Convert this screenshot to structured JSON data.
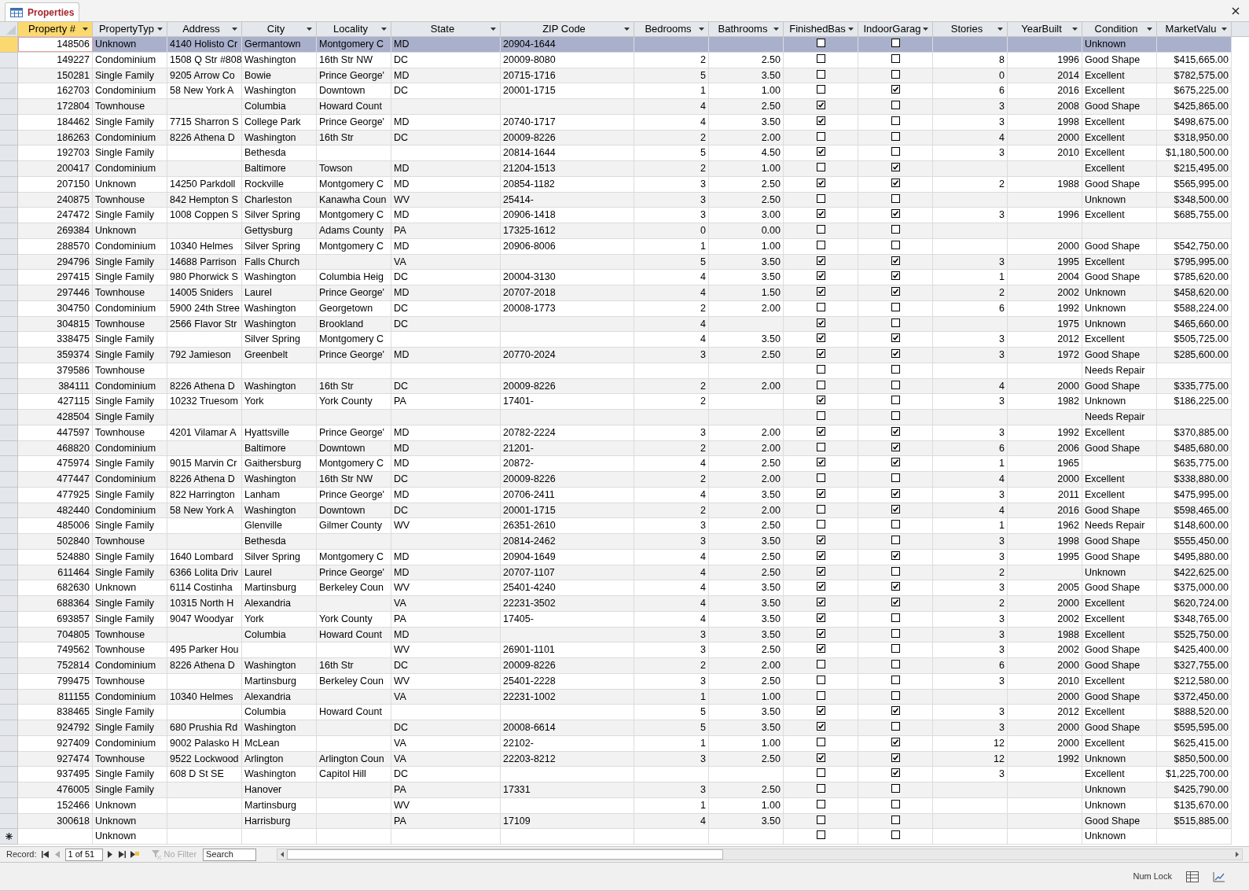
{
  "tab": {
    "title": "Properties"
  },
  "columns": [
    {
      "label": "Property #",
      "kind": "number",
      "selected": true
    },
    {
      "label": "PropertyTyp",
      "kind": "text",
      "selected": false
    },
    {
      "label": "Address",
      "kind": "text",
      "selected": false
    },
    {
      "label": "City",
      "kind": "text",
      "selected": false
    },
    {
      "label": "Locality",
      "kind": "text",
      "selected": false
    },
    {
      "label": "State",
      "kind": "wide",
      "selected": false
    },
    {
      "label": "ZIP Code",
      "kind": "wider",
      "selected": false
    },
    {
      "label": "Bedrooms",
      "kind": "number",
      "selected": false
    },
    {
      "label": "Bathrooms",
      "kind": "number",
      "selected": false
    },
    {
      "label": "FinishedBas",
      "kind": "check",
      "selected": false
    },
    {
      "label": "IndoorGarag",
      "kind": "check",
      "selected": false
    },
    {
      "label": "Stories",
      "kind": "number",
      "selected": false
    },
    {
      "label": "YearBuilt",
      "kind": "number",
      "selected": false
    },
    {
      "label": "Condition",
      "kind": "text",
      "selected": false
    },
    {
      "label": "MarketValu",
      "kind": "number",
      "selected": false
    }
  ],
  "rows": [
    {
      "kind": "record",
      "selected": true,
      "cells": [
        "148506",
        "Unknown",
        "4140 Holisto Cr",
        "Germantown",
        "Montgomery C",
        "MD",
        "20904-1644",
        null,
        null,
        false,
        false,
        null,
        null,
        "Unknown",
        null
      ]
    },
    {
      "kind": "record",
      "selected": false,
      "cells": [
        "149227",
        "Condominium",
        "1508 Q Str #808",
        "Washington",
        "16th Str NW",
        "DC",
        "20009-8080",
        "2",
        "2.50",
        false,
        false,
        "8",
        "1996",
        "Good Shape",
        "$415,665.00"
      ]
    },
    {
      "kind": "record",
      "selected": false,
      "cells": [
        "150281",
        "Single Family",
        "9205 Arrow Co",
        "Bowie",
        "Prince George'",
        "MD",
        "20715-1716",
        "5",
        "3.50",
        false,
        false,
        "0",
        "2014",
        "Excellent",
        "$782,575.00"
      ]
    },
    {
      "kind": "record",
      "selected": false,
      "cells": [
        "162703",
        "Condominium",
        "58 New York A",
        "Washington",
        "Downtown",
        "DC",
        "20001-1715",
        "1",
        "1.00",
        false,
        true,
        "6",
        "2016",
        "Excellent",
        "$675,225.00"
      ]
    },
    {
      "kind": "record",
      "selected": false,
      "cells": [
        "172804",
        "Townhouse",
        null,
        "Columbia",
        "Howard Count",
        null,
        null,
        "4",
        "2.50",
        true,
        false,
        "3",
        "2008",
        "Good Shape",
        "$425,865.00"
      ]
    },
    {
      "kind": "record",
      "selected": false,
      "cells": [
        "184462",
        "Single Family",
        "7715 Sharron S",
        "College Park",
        "Prince George'",
        "MD",
        "20740-1717",
        "4",
        "3.50",
        true,
        false,
        "3",
        "1998",
        "Excellent",
        "$498,675.00"
      ]
    },
    {
      "kind": "record",
      "selected": false,
      "cells": [
        "186263",
        "Condominium",
        "8226 Athena D",
        "Washington",
        "16th Str",
        "DC",
        "20009-8226",
        "2",
        "2.00",
        false,
        false,
        "4",
        "2000",
        "Excellent",
        "$318,950.00"
      ]
    },
    {
      "kind": "record",
      "selected": false,
      "cells": [
        "192703",
        "Single Family",
        null,
        "Bethesda",
        null,
        null,
        "20814-1644",
        "5",
        "4.50",
        true,
        false,
        "3",
        "2010",
        "Excellent",
        "$1,180,500.00"
      ]
    },
    {
      "kind": "record",
      "selected": false,
      "cells": [
        "200417",
        "Condominium",
        null,
        "Baltimore",
        "Towson",
        "MD",
        "21204-1513",
        "2",
        "1.00",
        false,
        true,
        null,
        null,
        "Excellent",
        "$215,495.00"
      ]
    },
    {
      "kind": "record",
      "selected": false,
      "cells": [
        "207150",
        "Unknown",
        "14250 Parkdoll",
        "Rockville",
        "Montgomery C",
        "MD",
        "20854-1182",
        "3",
        "2.50",
        true,
        true,
        "2",
        "1988",
        "Good Shape",
        "$565,995.00"
      ]
    },
    {
      "kind": "record",
      "selected": false,
      "cells": [
        "240875",
        "Townhouse",
        "842 Hempton S",
        "Charleston",
        "Kanawha Coun",
        "WV",
        "25414-",
        "3",
        "2.50",
        false,
        false,
        null,
        null,
        "Unknown",
        "$348,500.00"
      ]
    },
    {
      "kind": "record",
      "selected": false,
      "cells": [
        "247472",
        "Single Family",
        "1008 Coppen S",
        "Silver Spring",
        "Montgomery C",
        "MD",
        "20906-1418",
        "3",
        "3.00",
        true,
        true,
        "3",
        "1996",
        "Excellent",
        "$685,755.00"
      ]
    },
    {
      "kind": "record",
      "selected": false,
      "cells": [
        "269384",
        "Unknown",
        null,
        "Gettysburg",
        "Adams County",
        "PA",
        "17325-1612",
        "0",
        "0.00",
        false,
        false,
        null,
        null,
        null,
        null
      ]
    },
    {
      "kind": "record",
      "selected": false,
      "cells": [
        "288570",
        "Condominium",
        "10340 Helmes",
        "Silver Spring",
        "Montgomery C",
        "MD",
        "20906-8006",
        "1",
        "1.00",
        false,
        false,
        null,
        "2000",
        "Good Shape",
        "$542,750.00"
      ]
    },
    {
      "kind": "record",
      "selected": false,
      "cells": [
        "294796",
        "Single Family",
        "14688 Parrison",
        "Falls Church",
        null,
        "VA",
        null,
        "5",
        "3.50",
        true,
        true,
        "3",
        "1995",
        "Excellent",
        "$795,995.00"
      ]
    },
    {
      "kind": "record",
      "selected": false,
      "cells": [
        "297415",
        "Single Family",
        "980 Phorwick S",
        "Washington",
        "Columbia Heig",
        "DC",
        "20004-3130",
        "4",
        "3.50",
        true,
        true,
        "1",
        "2004",
        "Good Shape",
        "$785,620.00"
      ]
    },
    {
      "kind": "record",
      "selected": false,
      "cells": [
        "297446",
        "Townhouse",
        "14005 Sniders",
        "Laurel",
        "Prince George'",
        "MD",
        "20707-2018",
        "4",
        "1.50",
        true,
        true,
        "2",
        "2002",
        "Unknown",
        "$458,620.00"
      ]
    },
    {
      "kind": "record",
      "selected": false,
      "cells": [
        "304750",
        "Condominium",
        "5900 24th Stree",
        "Washington",
        "Georgetown",
        "DC",
        "20008-1773",
        "2",
        "2.00",
        false,
        false,
        "6",
        "1992",
        "Unknown",
        "$588,224.00"
      ]
    },
    {
      "kind": "record",
      "selected": false,
      "cells": [
        "304815",
        "Townhouse",
        "2566 Flavor Str",
        "Washington",
        "Brookland",
        "DC",
        null,
        "4",
        null,
        true,
        false,
        null,
        "1975",
        "Unknown",
        "$465,660.00"
      ]
    },
    {
      "kind": "record",
      "selected": false,
      "cells": [
        "338475",
        "Single Family",
        null,
        "Silver Spring",
        "Montgomery C",
        null,
        null,
        "4",
        "3.50",
        true,
        true,
        "3",
        "2012",
        "Excellent",
        "$505,725.00"
      ]
    },
    {
      "kind": "record",
      "selected": false,
      "cells": [
        "359374",
        "Single Family",
        "792 Jamieson",
        "Greenbelt",
        "Prince George'",
        "MD",
        "20770-2024",
        "3",
        "2.50",
        true,
        true,
        "3",
        "1972",
        "Good Shape",
        "$285,600.00"
      ]
    },
    {
      "kind": "record",
      "selected": false,
      "cells": [
        "379586",
        "Townhouse",
        null,
        null,
        null,
        null,
        null,
        null,
        null,
        false,
        false,
        null,
        null,
        "Needs Repair",
        null
      ]
    },
    {
      "kind": "record",
      "selected": false,
      "cells": [
        "384111",
        "Condominium",
        "8226 Athena D",
        "Washington",
        "16th Str",
        "DC",
        "20009-8226",
        "2",
        "2.00",
        false,
        false,
        "4",
        "2000",
        "Good Shape",
        "$335,775.00"
      ]
    },
    {
      "kind": "record",
      "selected": false,
      "cells": [
        "427115",
        "Single Family",
        "10232 Truesom",
        "York",
        "York County",
        "PA",
        "17401-",
        "2",
        null,
        true,
        false,
        "3",
        "1982",
        "Unknown",
        "$186,225.00"
      ]
    },
    {
      "kind": "record",
      "selected": false,
      "cells": [
        "428504",
        "Single Family",
        null,
        null,
        null,
        null,
        null,
        null,
        null,
        false,
        false,
        null,
        null,
        "Needs Repair",
        null
      ]
    },
    {
      "kind": "record",
      "selected": false,
      "cells": [
        "447597",
        "Townhouse",
        "4201 Vilamar A",
        "Hyattsville",
        "Prince George'",
        "MD",
        "20782-2224",
        "3",
        "2.00",
        true,
        true,
        "3",
        "1992",
        "Excellent",
        "$370,885.00"
      ]
    },
    {
      "kind": "record",
      "selected": false,
      "cells": [
        "468820",
        "Condominium",
        null,
        "Baltimore",
        "Downtown",
        "MD",
        "21201-",
        "2",
        "2.00",
        false,
        true,
        "6",
        "2006",
        "Good Shape",
        "$485,680.00"
      ]
    },
    {
      "kind": "record",
      "selected": false,
      "cells": [
        "475974",
        "Single Family",
        "9015 Marvin Cr",
        "Gaithersburg",
        "Montgomery C",
        "MD",
        "20872-",
        "4",
        "2.50",
        true,
        true,
        "1",
        "1965",
        null,
        "$635,775.00"
      ]
    },
    {
      "kind": "record",
      "selected": false,
      "cells": [
        "477447",
        "Condominium",
        "8226 Athena D",
        "Washington",
        "16th Str NW",
        "DC",
        "20009-8226",
        "2",
        "2.00",
        false,
        false,
        "4",
        "2000",
        "Excellent",
        "$338,880.00"
      ]
    },
    {
      "kind": "record",
      "selected": false,
      "cells": [
        "477925",
        "Single Family",
        "822 Harrington",
        "Lanham",
        "Prince George'",
        "MD",
        "20706-2411",
        "4",
        "3.50",
        true,
        true,
        "3",
        "2011",
        "Excellent",
        "$475,995.00"
      ]
    },
    {
      "kind": "record",
      "selected": false,
      "cells": [
        "482440",
        "Condominium",
        "58 New York A",
        "Washington",
        "Downtown",
        "DC",
        "20001-1715",
        "2",
        "2.00",
        false,
        true,
        "4",
        "2016",
        "Good Shape",
        "$598,465.00"
      ]
    },
    {
      "kind": "record",
      "selected": false,
      "cells": [
        "485006",
        "Single Family",
        null,
        "Glenville",
        "Gilmer County",
        "WV",
        "26351-2610",
        "3",
        "2.50",
        false,
        false,
        "1",
        "1962",
        "Needs Repair",
        "$148,600.00"
      ]
    },
    {
      "kind": "record",
      "selected": false,
      "cells": [
        "502840",
        "Townhouse",
        null,
        "Bethesda",
        null,
        null,
        "20814-2462",
        "3",
        "3.50",
        true,
        false,
        "3",
        "1998",
        "Good Shape",
        "$555,450.00"
      ]
    },
    {
      "kind": "record",
      "selected": false,
      "cells": [
        "524880",
        "Single Family",
        "1640 Lombard",
        "Silver Spring",
        "Montgomery C",
        "MD",
        "20904-1649",
        "4",
        "2.50",
        true,
        true,
        "3",
        "1995",
        "Good Shape",
        "$495,880.00"
      ]
    },
    {
      "kind": "record",
      "selected": false,
      "cells": [
        "611464",
        "Single Family",
        "6366 Lolita Driv",
        "Laurel",
        "Prince George'",
        "MD",
        "20707-1107",
        "4",
        "2.50",
        true,
        false,
        "2",
        null,
        "Unknown",
        "$422,625.00"
      ]
    },
    {
      "kind": "record",
      "selected": false,
      "cells": [
        "682630",
        "Unknown",
        "6114 Costinha",
        "Martinsburg",
        "Berkeley Coun",
        "WV",
        "25401-4240",
        "4",
        "3.50",
        true,
        true,
        "3",
        "2005",
        "Good Shape",
        "$375,000.00"
      ]
    },
    {
      "kind": "record",
      "selected": false,
      "cells": [
        "688364",
        "Single Family",
        "10315 North H",
        "Alexandria",
        null,
        "VA",
        "22231-3502",
        "4",
        "3.50",
        true,
        true,
        "2",
        "2000",
        "Excellent",
        "$620,724.00"
      ]
    },
    {
      "kind": "record",
      "selected": false,
      "cells": [
        "693857",
        "Single Family",
        "9047 Woodyar",
        "York",
        "York County",
        "PA",
        "17405-",
        "4",
        "3.50",
        true,
        false,
        "3",
        "2002",
        "Excellent",
        "$348,765.00"
      ]
    },
    {
      "kind": "record",
      "selected": false,
      "cells": [
        "704805",
        "Townhouse",
        null,
        "Columbia",
        "Howard Count",
        "MD",
        null,
        "3",
        "3.50",
        true,
        false,
        "3",
        "1988",
        "Excellent",
        "$525,750.00"
      ]
    },
    {
      "kind": "record",
      "selected": false,
      "cells": [
        "749562",
        "Townhouse",
        "495 Parker Hou",
        null,
        null,
        "WV",
        "26901-1101",
        "3",
        "2.50",
        true,
        false,
        "3",
        "2002",
        "Good Shape",
        "$425,400.00"
      ]
    },
    {
      "kind": "record",
      "selected": false,
      "cells": [
        "752814",
        "Condominium",
        "8226 Athena D",
        "Washington",
        "16th Str",
        "DC",
        "20009-8226",
        "2",
        "2.00",
        false,
        false,
        "6",
        "2000",
        "Good Shape",
        "$327,755.00"
      ]
    },
    {
      "kind": "record",
      "selected": false,
      "cells": [
        "799475",
        "Townhouse",
        null,
        "Martinsburg",
        "Berkeley Coun",
        "WV",
        "25401-2228",
        "3",
        "2.50",
        false,
        false,
        "3",
        "2010",
        "Excellent",
        "$212,580.00"
      ]
    },
    {
      "kind": "record",
      "selected": false,
      "cells": [
        "811155",
        "Condominium",
        "10340 Helmes",
        "Alexandria",
        null,
        "VA",
        "22231-1002",
        "1",
        "1.00",
        false,
        false,
        null,
        "2000",
        "Good Shape",
        "$372,450.00"
      ]
    },
    {
      "kind": "record",
      "selected": false,
      "cells": [
        "838465",
        "Single Family",
        null,
        "Columbia",
        "Howard Count",
        null,
        null,
        "5",
        "3.50",
        true,
        true,
        "3",
        "2012",
        "Excellent",
        "$888,520.00"
      ]
    },
    {
      "kind": "record",
      "selected": false,
      "cells": [
        "924792",
        "Single Family",
        "680 Prushia Rd",
        "Washington",
        null,
        "DC",
        "20008-6614",
        "5",
        "3.50",
        true,
        false,
        "3",
        "2000",
        "Good Shape",
        "$595,595.00"
      ]
    },
    {
      "kind": "record",
      "selected": false,
      "cells": [
        "927409",
        "Condominium",
        "9002 Palasko H",
        "McLean",
        null,
        "VA",
        "22102-",
        "1",
        "1.00",
        false,
        true,
        "12",
        "2000",
        "Excellent",
        "$625,415.00"
      ]
    },
    {
      "kind": "record",
      "selected": false,
      "cells": [
        "927474",
        "Townhouse",
        "9522 Lockwood",
        "Arlington",
        "Arlington Coun",
        "VA",
        "22203-8212",
        "3",
        "2.50",
        true,
        true,
        "12",
        "1992",
        "Unknown",
        "$850,500.00"
      ]
    },
    {
      "kind": "record",
      "selected": false,
      "cells": [
        "937495",
        "Single Family",
        "608 D St SE",
        "Washington",
        "Capitol Hill",
        "DC",
        null,
        null,
        null,
        false,
        true,
        "3",
        null,
        "Excellent",
        "$1,225,700.00"
      ]
    },
    {
      "kind": "record",
      "selected": false,
      "cells": [
        "476005",
        "Single Family",
        null,
        "Hanover",
        null,
        "PA",
        "17331",
        "3",
        "2.50",
        false,
        false,
        null,
        null,
        "Unknown",
        "$425,790.00"
      ]
    },
    {
      "kind": "record",
      "selected": false,
      "cells": [
        "152466",
        "Unknown",
        null,
        "Martinsburg",
        null,
        "WV",
        null,
        "1",
        "1.00",
        false,
        false,
        null,
        null,
        "Unknown",
        "$135,670.00"
      ]
    },
    {
      "kind": "record",
      "selected": false,
      "cells": [
        "300618",
        "Unknown",
        null,
        "Harrisburg",
        null,
        "PA",
        "17109",
        "4",
        "3.50",
        false,
        false,
        null,
        null,
        "Good Shape",
        "$515,885.00"
      ]
    },
    {
      "kind": "new",
      "selected": false,
      "cells": [
        null,
        "Unknown",
        null,
        null,
        null,
        null,
        null,
        null,
        null,
        false,
        false,
        null,
        null,
        "Unknown",
        null
      ]
    }
  ],
  "navigation": {
    "label": "Record:",
    "position": "1 of 51",
    "filter": {
      "label": "No Filter",
      "disabled": true
    },
    "search": {
      "placeholder": "Search"
    }
  },
  "status_bar": {
    "indicator": "Num Lock"
  }
}
